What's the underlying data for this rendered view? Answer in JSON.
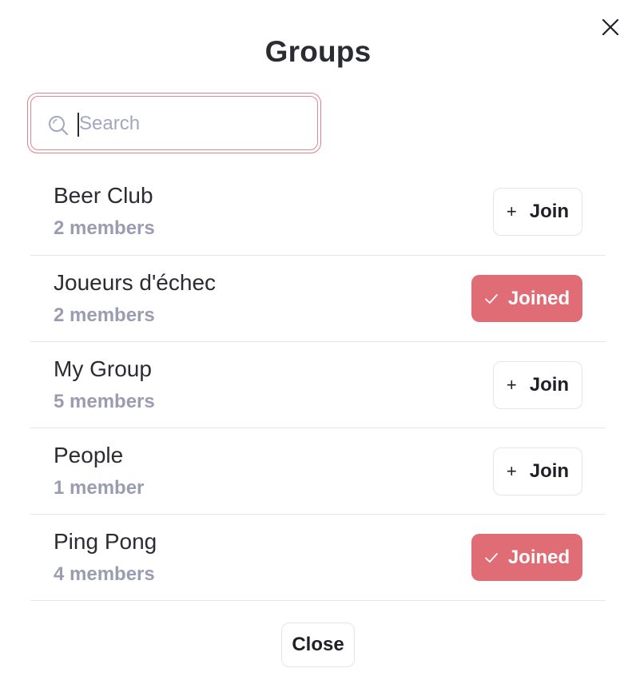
{
  "dialog": {
    "title": "Groups",
    "close_icon": "close-icon"
  },
  "search": {
    "placeholder": "Search",
    "value": "",
    "icon": "search-icon"
  },
  "groups": [
    {
      "name": "Beer Club",
      "members": "2 members",
      "status": "join",
      "button_label": "Join",
      "button_icon": "plus-icon"
    },
    {
      "name": "Joueurs d'échec",
      "members": "2 members",
      "status": "joined",
      "button_label": "Joined",
      "button_icon": "check-icon"
    },
    {
      "name": "My Group",
      "members": "5 members",
      "status": "join",
      "button_label": "Join",
      "button_icon": "plus-icon"
    },
    {
      "name": "People",
      "members": "1 member",
      "status": "join",
      "button_label": "Join",
      "button_icon": "plus-icon"
    },
    {
      "name": "Ping Pong",
      "members": "4 members",
      "status": "joined",
      "button_label": "Joined",
      "button_icon": "check-icon"
    }
  ],
  "footer": {
    "close_label": "Close"
  },
  "colors": {
    "accent": "#e06c75",
    "text": "#2b2b33",
    "muted": "#9a9cb2"
  }
}
